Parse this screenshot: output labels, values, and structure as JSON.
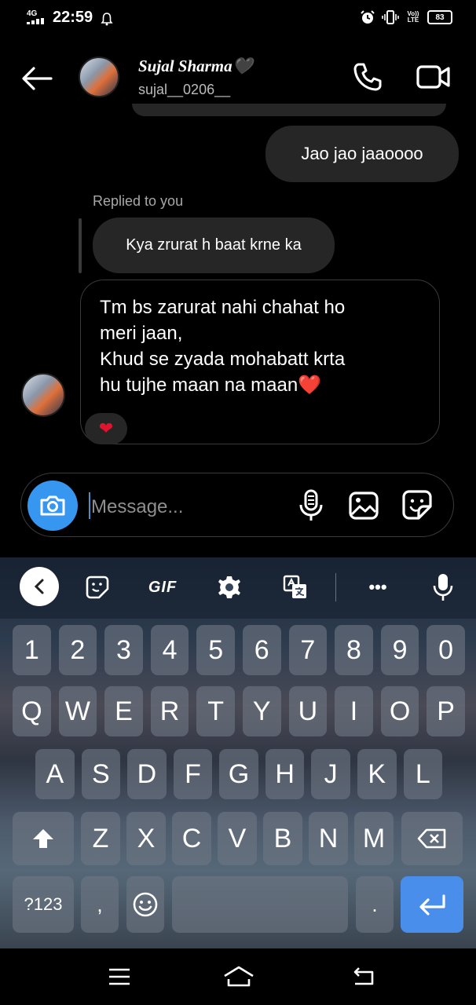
{
  "status_bar": {
    "network": "4G",
    "time": "22:59",
    "signal2": "Vo)) LTE",
    "battery": "83"
  },
  "header": {
    "name": "Sujal Sharma🖤",
    "username": "sujal__0206__"
  },
  "messages": {
    "outgoing": "Jao jao jaaoooo",
    "replied_label": "Replied to you",
    "quoted": "Kya zrurat h baat krne ka",
    "incoming": "Tm bs zarurat nahi chahat ho\nmeri jaan,\nKhud se zyada mohabatt krta\nhu tujhe maan na maan❤️",
    "reaction": "❤"
  },
  "composer": {
    "placeholder": "Message..."
  },
  "keyboard": {
    "toolbar": {
      "gif": "GIF",
      "more": "•••"
    },
    "row_numbers": [
      "1",
      "2",
      "3",
      "4",
      "5",
      "6",
      "7",
      "8",
      "9",
      "0"
    ],
    "row_q": [
      "Q",
      "W",
      "E",
      "R",
      "T",
      "Y",
      "U",
      "I",
      "O",
      "P"
    ],
    "row_a": [
      "A",
      "S",
      "D",
      "F",
      "G",
      "H",
      "J",
      "K",
      "L"
    ],
    "row_z": [
      "Z",
      "X",
      "C",
      "V",
      "B",
      "N",
      "M"
    ],
    "symbols_label": "?123",
    "comma": ",",
    "period": ".",
    "enter_color": "#4a8eeb"
  },
  "colors": {
    "accent": "#3797f0",
    "bubble": "#262626",
    "heart": "#e0142c"
  }
}
